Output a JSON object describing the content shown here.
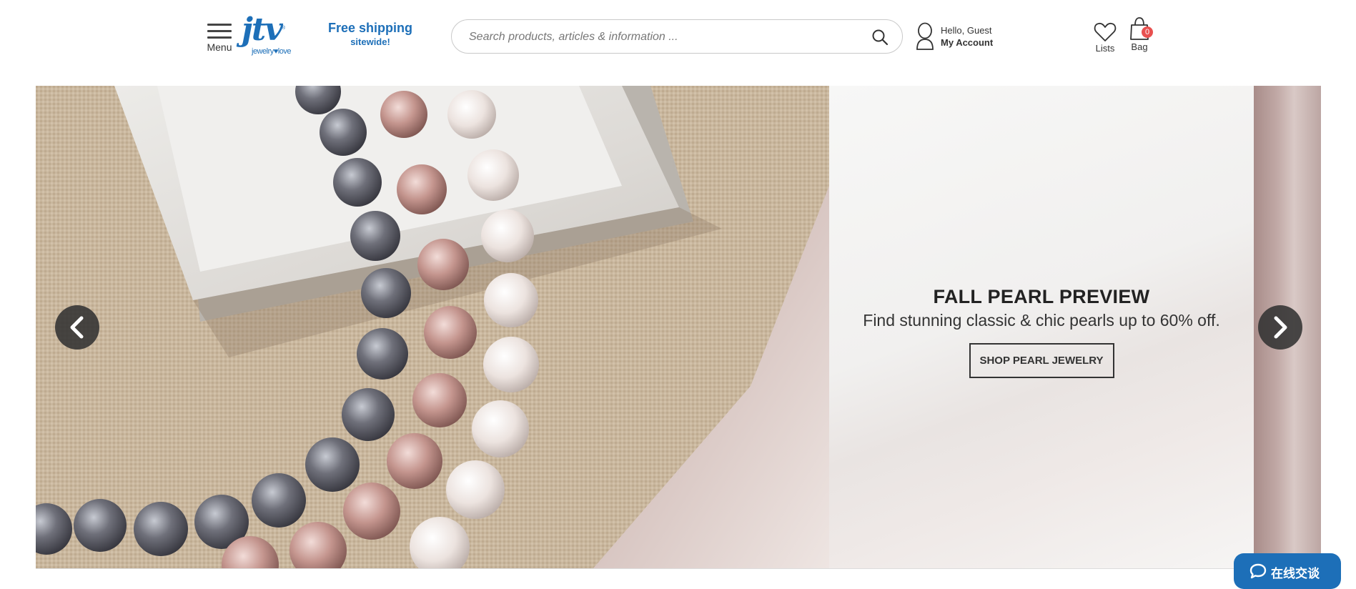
{
  "header": {
    "menu_label": "Menu",
    "logo": {
      "mark": "jtv",
      "tagline": "jewelry♥love"
    },
    "shipping": {
      "line1": "Free shipping",
      "line2": "sitewide!"
    },
    "search": {
      "placeholder": "Search products, articles & information ...",
      "value": ""
    },
    "account": {
      "greeting": "Hello, Guest",
      "link": "My Account"
    },
    "lists_label": "Lists",
    "bag": {
      "label": "Bag",
      "count": "0"
    }
  },
  "hero": {
    "title": "FALL PEARL PREVIEW",
    "subtitle": "Find stunning classic & chic pearls up to 60% off.",
    "cta": "SHOP PEARL JEWELRY"
  },
  "chat": {
    "label": "在线交谈"
  },
  "colors": {
    "brand_blue": "#1d6fb8",
    "badge_red": "#e8504f",
    "carousel_arrow": "#323232"
  },
  "icons": [
    "menu-icon",
    "search-icon",
    "user-icon",
    "heart-icon",
    "bag-icon",
    "chevron-left-icon",
    "chevron-right-icon",
    "chat-bubble-icon"
  ]
}
